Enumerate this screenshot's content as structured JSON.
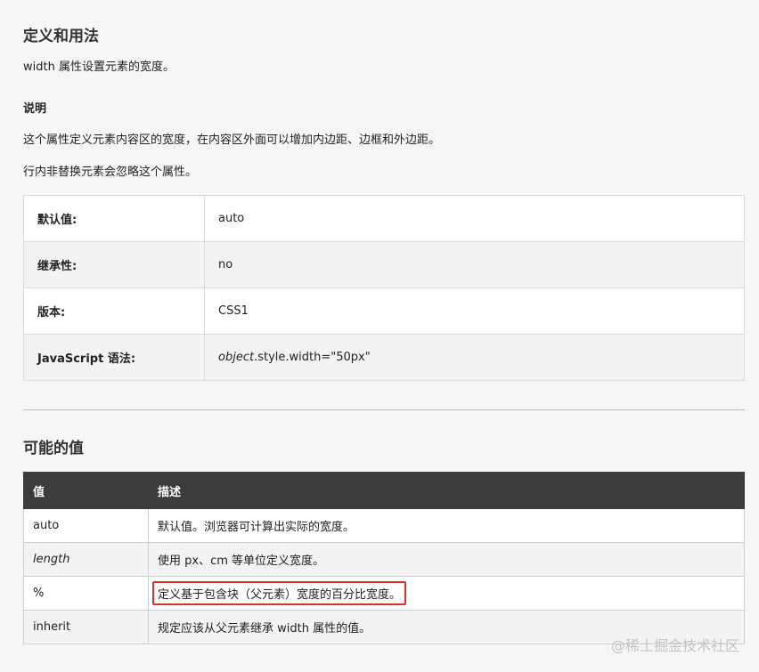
{
  "definition": {
    "title": "定义和用法",
    "text": "width 属性设置元素的宽度。"
  },
  "explanation": {
    "title": "说明",
    "lines": [
      "这个属性定义元素内容区的宽度，在内容区外面可以增加内边距、边框和外边距。",
      "行内非替换元素会忽略这个属性。"
    ]
  },
  "properties": [
    {
      "key": "默认值:",
      "value": "auto"
    },
    {
      "key": "继承性:",
      "value": "no"
    },
    {
      "key": "版本:",
      "value": "CSS1"
    },
    {
      "key": "JavaScript 语法:",
      "value_italic": "object",
      "value": ".style.width=\"50px\""
    }
  ],
  "possible_values": {
    "title": "可能的值",
    "headers": [
      "值",
      "描述"
    ],
    "rows": [
      {
        "value": "auto",
        "description": "默认值。浏览器可计算出实际的宽度。"
      },
      {
        "value": "length",
        "description": "使用 px、cm 等单位定义宽度。"
      },
      {
        "value": "%",
        "description": "定义基于包含块（父元素）宽度的百分比宽度。"
      },
      {
        "value": "inherit",
        "description": "规定应该从父元素继承 width 属性的值。"
      }
    ]
  },
  "watermark": "@稀土掘金技术社区",
  "colors": {
    "table_header_bg": "#3c3c3c",
    "highlight_border": "#d9302b"
  }
}
